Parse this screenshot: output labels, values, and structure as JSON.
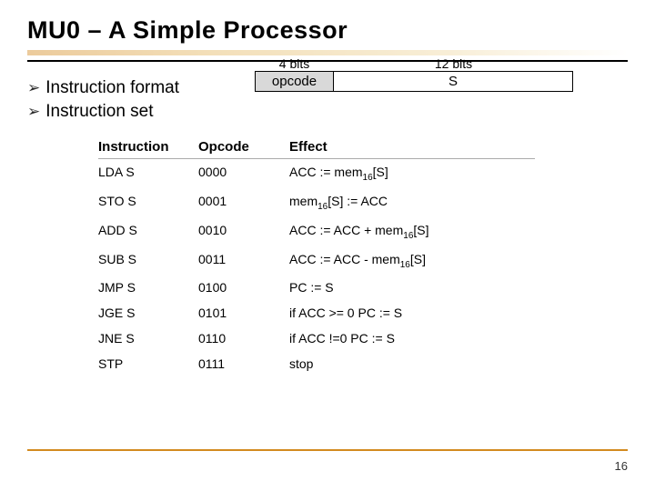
{
  "title": "MU0 – A Simple Processor",
  "bullets": {
    "b1": "Instruction format",
    "b2": "Instruction set"
  },
  "format": {
    "bits4": "4 bits",
    "bits12": "12 bits",
    "opcode": "opcode",
    "s": "S"
  },
  "table": {
    "headers": {
      "instruction": "Instruction",
      "opcode": "Opcode",
      "effect": "Effect"
    },
    "rows": [
      {
        "instr": "LDA S",
        "op": "0000",
        "eff_pre": "ACC := mem",
        "eff_sub": "16",
        "eff_post": "[S]"
      },
      {
        "instr": "STO S",
        "op": "0001",
        "eff_pre": "mem",
        "eff_sub": "16",
        "eff_post": "[S] := ACC"
      },
      {
        "instr": "ADD S",
        "op": "0010",
        "eff_pre": "ACC := ACC + mem",
        "eff_sub": "16",
        "eff_post": "[S]"
      },
      {
        "instr": "SUB S",
        "op": "0011",
        "eff_pre": "ACC := ACC - mem",
        "eff_sub": "16",
        "eff_post": "[S]"
      },
      {
        "instr": "JMP S",
        "op": "0100",
        "eff_pre": "PC := S",
        "eff_sub": "",
        "eff_post": ""
      },
      {
        "instr": "JGE S",
        "op": "0101",
        "eff_pre": "if  ACC >= 0 PC := S",
        "eff_sub": "",
        "eff_post": ""
      },
      {
        "instr": "JNE S",
        "op": "0110",
        "eff_pre": "if  ACC !=0 PC := S",
        "eff_sub": "",
        "eff_post": ""
      },
      {
        "instr": "STP",
        "op": "0111",
        "eff_pre": "stop",
        "eff_sub": "",
        "eff_post": ""
      }
    ]
  },
  "page": "16"
}
